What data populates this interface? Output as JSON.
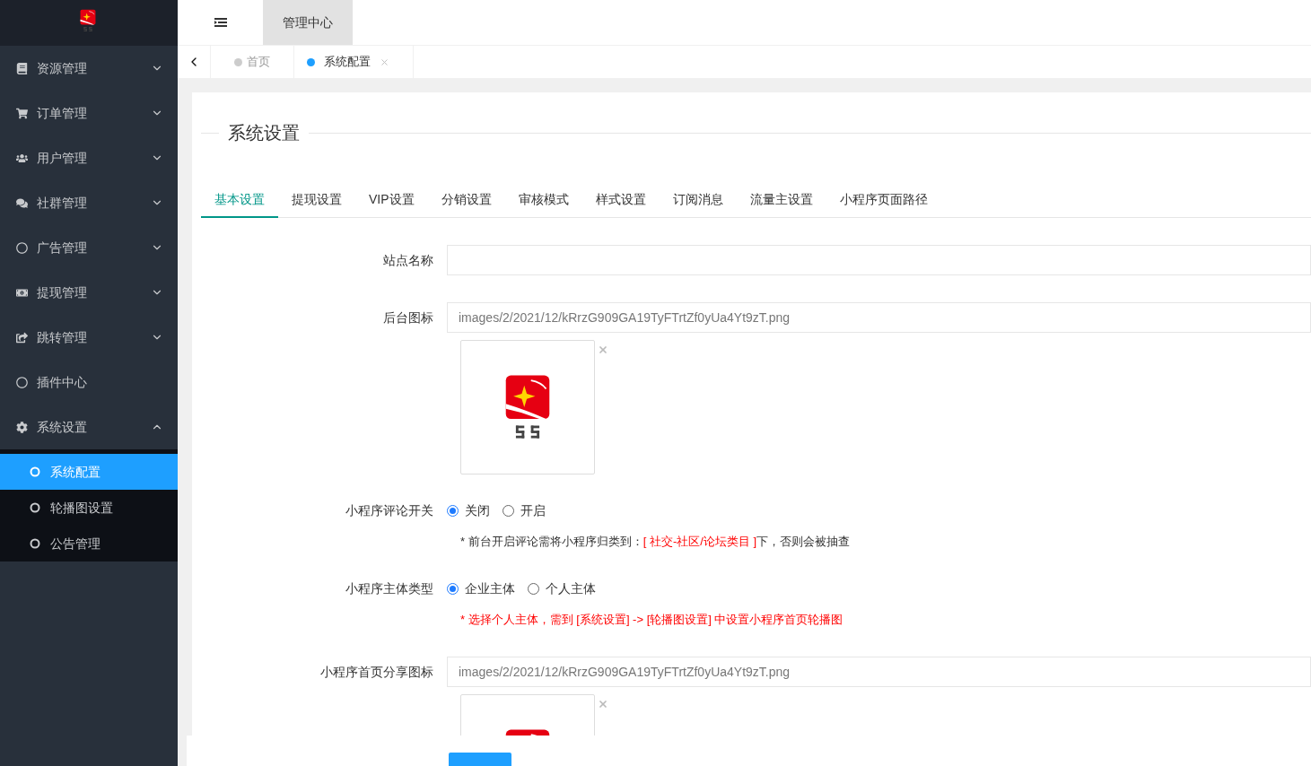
{
  "header": {
    "tabs": [
      {
        "label": "管理中心",
        "selected": true
      }
    ]
  },
  "sidebar": {
    "items": [
      {
        "label": "资源管理",
        "kind": "group",
        "expanded": false
      },
      {
        "label": "订单管理",
        "kind": "group",
        "expanded": false
      },
      {
        "label": "用户管理",
        "kind": "group",
        "expanded": false
      },
      {
        "label": "社群管理",
        "kind": "group",
        "expanded": false
      },
      {
        "label": "广告管理",
        "kind": "group",
        "expanded": false
      },
      {
        "label": "提现管理",
        "kind": "group",
        "expanded": false
      },
      {
        "label": "跳转管理",
        "kind": "group",
        "expanded": false
      },
      {
        "label": "插件中心",
        "kind": "link"
      },
      {
        "label": "系统设置",
        "kind": "group",
        "expanded": true,
        "children": [
          {
            "label": "系统配置",
            "selected": true
          },
          {
            "label": "轮播图设置",
            "selected": false
          },
          {
            "label": "公告管理",
            "selected": false
          }
        ]
      }
    ]
  },
  "page_tabs": [
    {
      "label": "首页",
      "selected": false
    },
    {
      "label": "系统配置",
      "selected": true,
      "closable": true
    }
  ],
  "section_title": "系统设置",
  "settings_tabs": [
    {
      "label": "基本设置",
      "selected": true
    },
    {
      "label": "提现设置",
      "selected": false
    },
    {
      "label": "VIP设置",
      "selected": false
    },
    {
      "label": "分销设置",
      "selected": false
    },
    {
      "label": "审核模式",
      "selected": false
    },
    {
      "label": "样式设置",
      "selected": false
    },
    {
      "label": "订阅消息",
      "selected": false
    },
    {
      "label": "流量主设置",
      "selected": false
    },
    {
      "label": "小程序页面路径",
      "selected": false
    }
  ],
  "form": [
    {
      "kind": "text",
      "label": "站点名称"
    },
    {
      "kind": "image",
      "label": "后台图标",
      "value": "images/2/2021/12/kRrzG909GA19TyFTrtZf0yUa4Yt9zT.png"
    },
    {
      "kind": "radio",
      "label": "小程序评论开关",
      "options": [
        {
          "label": "关闭",
          "selected": true
        },
        {
          "label": "开启",
          "selected": false
        }
      ],
      "hint": [
        {
          "text": "* 前台开启评论需将小程序归类到：",
          "highlight": false
        },
        {
          "text": "[ 社交-社区/论坛类目 ]",
          "highlight": true
        },
        {
          "text": "下，否则会被抽查",
          "highlight": false
        }
      ]
    },
    {
      "kind": "radio",
      "label": "小程序主体类型",
      "options": [
        {
          "label": "企业主体",
          "selected": true
        },
        {
          "label": "个人主体",
          "selected": false
        }
      ],
      "hint": [
        {
          "text": "* 选择个人主体，需到 [系统设置] -> [轮播图设置] 中设置小程序首页轮播图",
          "highlight": true
        }
      ]
    },
    {
      "kind": "image",
      "label": "小程序首页分享图标",
      "value": "images/2/2021/12/kRrzG909GA19TyFTrtZf0yUa4Yt9zT.png"
    }
  ]
}
